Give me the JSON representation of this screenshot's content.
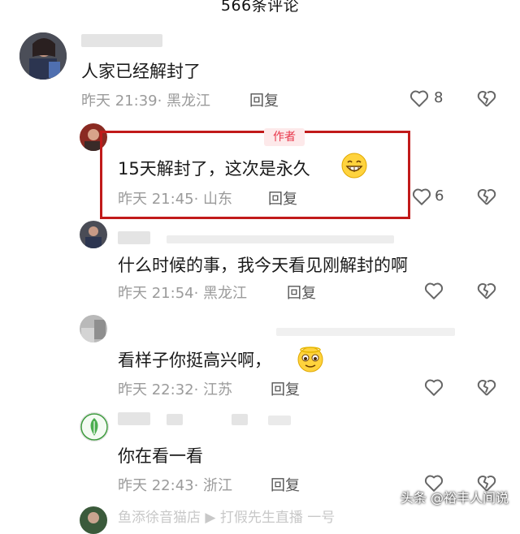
{
  "header": {
    "title": "566条评论"
  },
  "comments": [
    {
      "content": "人家已经解封了",
      "time": "昨天 21:39",
      "location": "· 黑龙江",
      "reply_label": "回复",
      "like_count": "8"
    },
    {
      "badge": "作者",
      "content": "15天解封了，这次是永久",
      "time": "昨天 21:45",
      "location": "· 山东",
      "reply_label": "回复",
      "like_count": "6"
    },
    {
      "content": "什么时候的事，我今天看见刚解封的啊",
      "time": "昨天 21:54",
      "location": "· 黑龙江",
      "reply_label": "回复",
      "like_count": ""
    },
    {
      "content": "看样子你挺高兴啊，",
      "time": "昨天 22:32",
      "location": "· 江苏",
      "reply_label": "回复",
      "like_count": ""
    },
    {
      "content": "你在看一看",
      "time": "昨天 22:43",
      "location": "· 浙江",
      "reply_label": "回复",
      "like_count": ""
    }
  ],
  "partial_next": {
    "text": "鱼添徐音猫店 ▶ 打假先生直播 一号"
  },
  "watermark": "头条 @裕丰人间说",
  "colors": {
    "author_badge": "#e8374b",
    "highlight_box": "#c11a1a"
  }
}
